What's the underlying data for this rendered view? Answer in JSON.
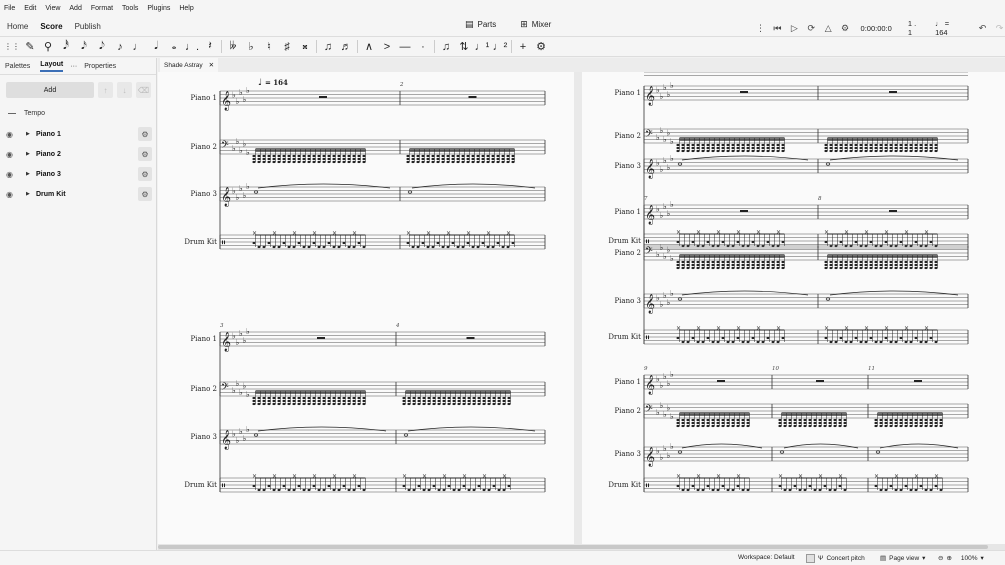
{
  "menu": [
    "File",
    "Edit",
    "View",
    "Add",
    "Format",
    "Tools",
    "Plugins",
    "Help"
  ],
  "tabs": [
    "Home",
    "Score",
    "Publish"
  ],
  "active_tab": "Score",
  "top_center": {
    "parts": "Parts",
    "mixer": "Mixer"
  },
  "playback": {
    "time": "0:00:00:0",
    "position": "1 . 1",
    "tempo": "= 164"
  },
  "panel": {
    "tabs": [
      "Palettes",
      "Layout",
      "Properties"
    ],
    "active_tab": "Layout",
    "tab_more": "···",
    "add_label": "Add",
    "tempo_label": "Tempo",
    "instruments": [
      "Piano 1",
      "Piano 2",
      "Piano 3",
      "Drum Kit"
    ]
  },
  "doc_tab": {
    "name": "Shade Astray"
  },
  "score": {
    "tempo_marking": "= 164",
    "staff_names": [
      "Piano 1",
      "Piano 2",
      "Piano 3",
      "Drum Kit"
    ],
    "measure_numbers": [
      "2",
      "3",
      "4",
      "7",
      "8",
      "9",
      "10",
      "11"
    ]
  },
  "statusbar": {
    "workspace": "Workspace: Default",
    "concert_pitch": "Concert pitch",
    "page_view": "Page view",
    "zoom": "100%"
  }
}
